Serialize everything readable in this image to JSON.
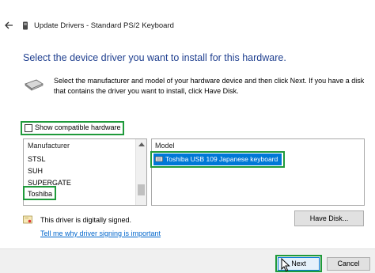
{
  "header": {
    "title": "Update Drivers - Standard PS/2 Keyboard",
    "back_icon": "back-arrow-icon",
    "title_icon": "keyboard-device-icon"
  },
  "main": {
    "heading": "Select the device driver you want to install for this hardware.",
    "instructions": "Select the manufacturer and model of your hardware device and then click Next. If you have a disk that contains the driver you want to install, click Have Disk.",
    "hardware_icon": "hardware-device-icon",
    "show_compatible_label": "Show compatible hardware",
    "show_compatible_checked": false
  },
  "manufacturer_list": {
    "header": "Manufacturer",
    "items": [
      "STSL",
      "SUH",
      "SUPERGATE",
      "Toshiba"
    ],
    "selected": "Toshiba"
  },
  "model_list": {
    "header": "Model",
    "items": [
      "Toshiba USB 109 Japanese keyboard"
    ],
    "selected": "Toshiba USB 109 Japanese keyboard"
  },
  "signature": {
    "text": "This driver is digitally signed.",
    "link": "Tell me why driver signing is important",
    "icon": "certificate-icon"
  },
  "buttons": {
    "have_disk": "Have Disk...",
    "next": "Next",
    "cancel": "Cancel"
  },
  "colors": {
    "heading": "#1f3f8f",
    "highlight_box": "#1f9a3b",
    "selection": "#0078d7",
    "link": "#0066cc"
  }
}
